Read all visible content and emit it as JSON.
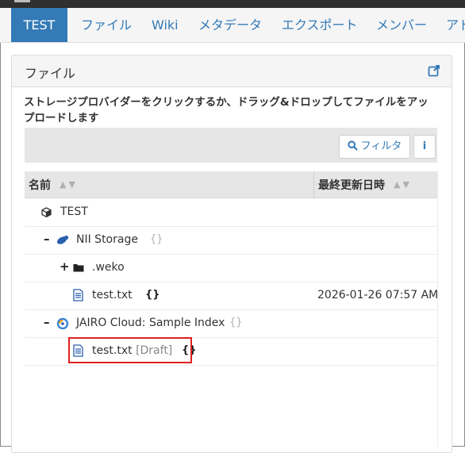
{
  "nav": {
    "items": [
      {
        "label": "TEST",
        "active": true
      },
      {
        "label": "ファイル"
      },
      {
        "label": "Wiki"
      },
      {
        "label": "メタデータ"
      },
      {
        "label": "エクスポート"
      },
      {
        "label": "メンバー"
      },
      {
        "label": "アド"
      }
    ]
  },
  "panel": {
    "title": "ファイル",
    "external_icon": "external-link-icon"
  },
  "instructions": "ストレージプロバイダーをクリックするか、ドラッグ&ドロップしてファイルをアップロードします",
  "toolbar": {
    "filter_label": "フィルタ",
    "filter_icon": "search-icon",
    "info_label": "i"
  },
  "grid": {
    "col_name": "名前",
    "col_modified": "最終更新日時"
  },
  "tree": {
    "root": {
      "label": "TEST",
      "icon": "cube-icon"
    },
    "provider1": {
      "label": "NII Storage",
      "toggle": "–",
      "icon": "storage-icon",
      "badge": "{}"
    },
    "folder1": {
      "label": ".weko",
      "toggle": "+",
      "icon": "folder-icon"
    },
    "file1": {
      "label": "test.txt",
      "icon": "file-icon",
      "badge": "{}",
      "modified": "2026-01-26 07:57 AM"
    },
    "provider2": {
      "label": "JAIRO Cloud: Sample Index",
      "toggle": "–",
      "icon": "jairo-icon",
      "badge": "{}"
    },
    "file2": {
      "label": "test.txt",
      "draft": "[Draft]",
      "icon": "file-icon",
      "badge": "{}"
    }
  },
  "colors": {
    "primary": "#337ab7",
    "highlight": "#e02020"
  }
}
